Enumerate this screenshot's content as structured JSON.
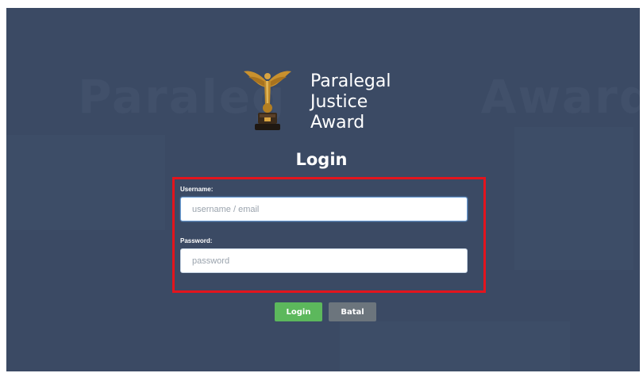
{
  "brand": {
    "logo_icon": "trophy-icon",
    "line1": "Paralegal",
    "line2": "Justice",
    "line3": "Award"
  },
  "login": {
    "title": "Login",
    "username_label": "Username:",
    "username_placeholder": "username / email",
    "username_value": "",
    "password_label": "Password:",
    "password_placeholder": "password",
    "password_value": "",
    "login_button": "Login",
    "cancel_button": "Batal"
  },
  "colors": {
    "background": "#3b4a64",
    "highlight": "#e3141d",
    "login_button": "#5cb85c",
    "cancel_button": "#6c757d"
  }
}
